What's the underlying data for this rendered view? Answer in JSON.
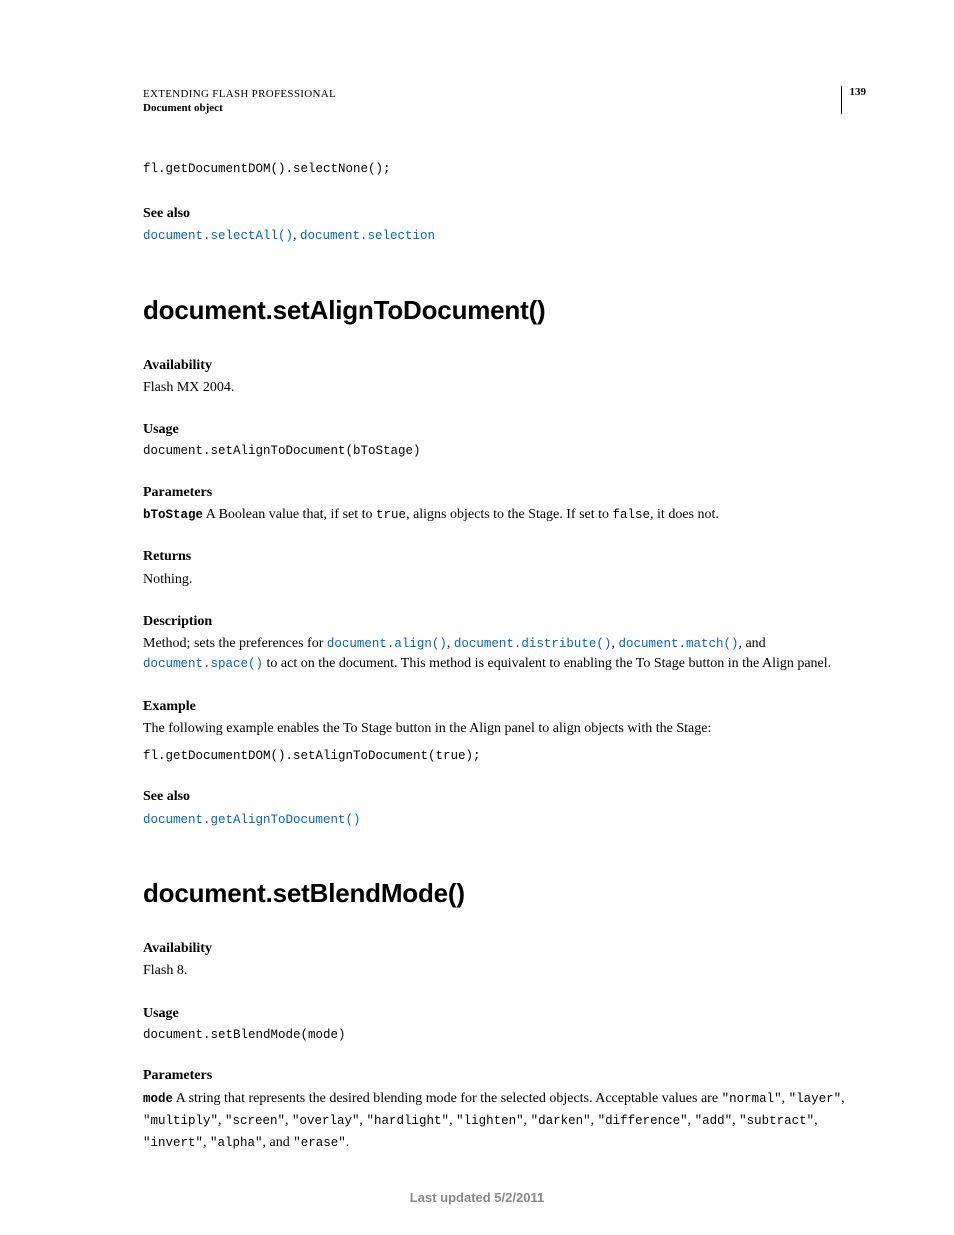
{
  "header": {
    "title": "EXTENDING FLASH PROFESSIONAL",
    "sub": "Document object",
    "pagenum": "139"
  },
  "topCode": "fl.getDocumentDOM().selectNone();",
  "topSeeAlso": {
    "heading": "See also",
    "link1": "document.selectAll()",
    "sep": ", ",
    "link2": "document.selection"
  },
  "sec1": {
    "title": "document.setAlignToDocument()",
    "availability": {
      "h": "Availability",
      "t": "Flash MX 2004."
    },
    "usage": {
      "h": "Usage",
      "code": "document.setAlignToDocument(bToStage)"
    },
    "params": {
      "h": "Parameters",
      "name": "bToStage",
      "pre": "  A Boolean value that, if set to ",
      "c1": "true",
      "mid": ", aligns objects to the Stage. If set to ",
      "c2": "false",
      "post": ", it does not."
    },
    "returns": {
      "h": "Returns",
      "t": "Nothing."
    },
    "desc": {
      "h": "Description",
      "pre": "Method; sets the preferences for ",
      "l1": "document.align()",
      "s1": ", ",
      "l2": "document.distribute()",
      "s2": ", ",
      "l3": "document.match()",
      "s3": ", and ",
      "l4": "document.space()",
      "post": " to act on the document. This method is equivalent to enabling the To Stage button in the Align panel."
    },
    "example": {
      "h": "Example",
      "t": "The following example enables the To Stage button in the Align panel to align objects with the Stage:",
      "code": "fl.getDocumentDOM().setAlignToDocument(true);"
    },
    "seealso": {
      "h": "See also",
      "l": "document.getAlignToDocument()"
    }
  },
  "sec2": {
    "title": "document.setBlendMode()",
    "availability": {
      "h": "Availability",
      "t": "Flash 8."
    },
    "usage": {
      "h": "Usage",
      "code": "document.setBlendMode(mode)"
    },
    "params": {
      "h": "Parameters",
      "name": "mode",
      "pre": "  A string that represents the desired blending mode for the selected objects. Acceptable values are ",
      "v1": "\"normal\"",
      "s1": ", ",
      "v2": "\"layer\"",
      "s2": ", ",
      "v3": "\"multiply\"",
      "s3": ", ",
      "v4": "\"screen\"",
      "s4": ", ",
      "v5": "\"overlay\"",
      "s5": ", ",
      "v6": "\"hardlight\"",
      "s6": ", ",
      "v7": "\"lighten\"",
      "s7": ", ",
      "v8": "\"darken\"",
      "s8": ", ",
      "v9": "\"difference\"",
      "s9": ", ",
      "v10": "\"add\"",
      "s10": ", ",
      "v11": "\"subtract\"",
      "s11": ", ",
      "v12": "\"invert\"",
      "s12": ", ",
      "v13": "\"alpha\"",
      "s13": ", and ",
      "v14": "\"erase\"",
      "s14": "."
    }
  },
  "footer": "Last updated 5/2/2011"
}
